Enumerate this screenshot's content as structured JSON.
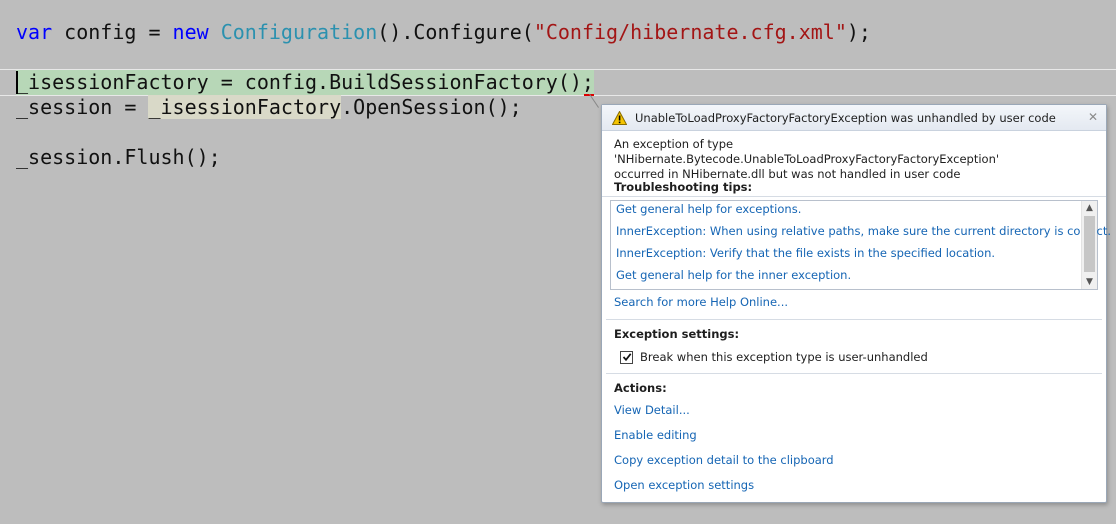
{
  "code": {
    "line1": {
      "kw_var": "var",
      "name": " config = ",
      "kw_new": "new",
      "space": " ",
      "type": "Configuration",
      "call": "().Configure(",
      "string": "\"Config/hibernate.cfg.xml\"",
      "end": ");"
    },
    "line2": {
      "var": "_isessionFactory",
      "rest": " = config.BuildSessionFactory();"
    },
    "line3": {
      "lhs": "_session = ",
      "ref": "_isessionFactory",
      "rest": ".OpenSession();"
    },
    "line4": "_session.Flush();"
  },
  "exception": {
    "title": "UnableToLoadProxyFactoryFactoryException was unhandled by user code",
    "message_line1": "An exception of type 'NHibernate.Bytecode.UnableToLoadProxyFactoryFactoryException'",
    "message_line2": "occurred in NHibernate.dll but was not handled in user code",
    "close_glyph": "✕",
    "troubleshooting_title": "Troubleshooting tips:",
    "tips": [
      "Get general help for exceptions.",
      "InnerException: When using relative paths, make sure the current directory is correct.",
      "InnerException: Verify that the file exists in the specified location.",
      "Get general help for the inner exception."
    ],
    "search_online": "Search for more Help Online...",
    "settings_title": "Exception settings:",
    "break_option": "Break when this exception type is user-unhandled",
    "break_checked": true,
    "actions_title": "Actions:",
    "actions": [
      "View Detail...",
      "Enable editing",
      "Copy exception detail to the clipboard",
      "Open exception settings"
    ]
  },
  "colors": {
    "editor_bg": "#bdbdbd",
    "keyword": "#0000ff",
    "type": "#2b91af",
    "string": "#a31515",
    "link": "#1565b4",
    "warning": "#f5c400"
  },
  "icons": {
    "warning": "warning-icon",
    "close": "close-icon",
    "checkbox": "checkbox-checked-icon"
  }
}
